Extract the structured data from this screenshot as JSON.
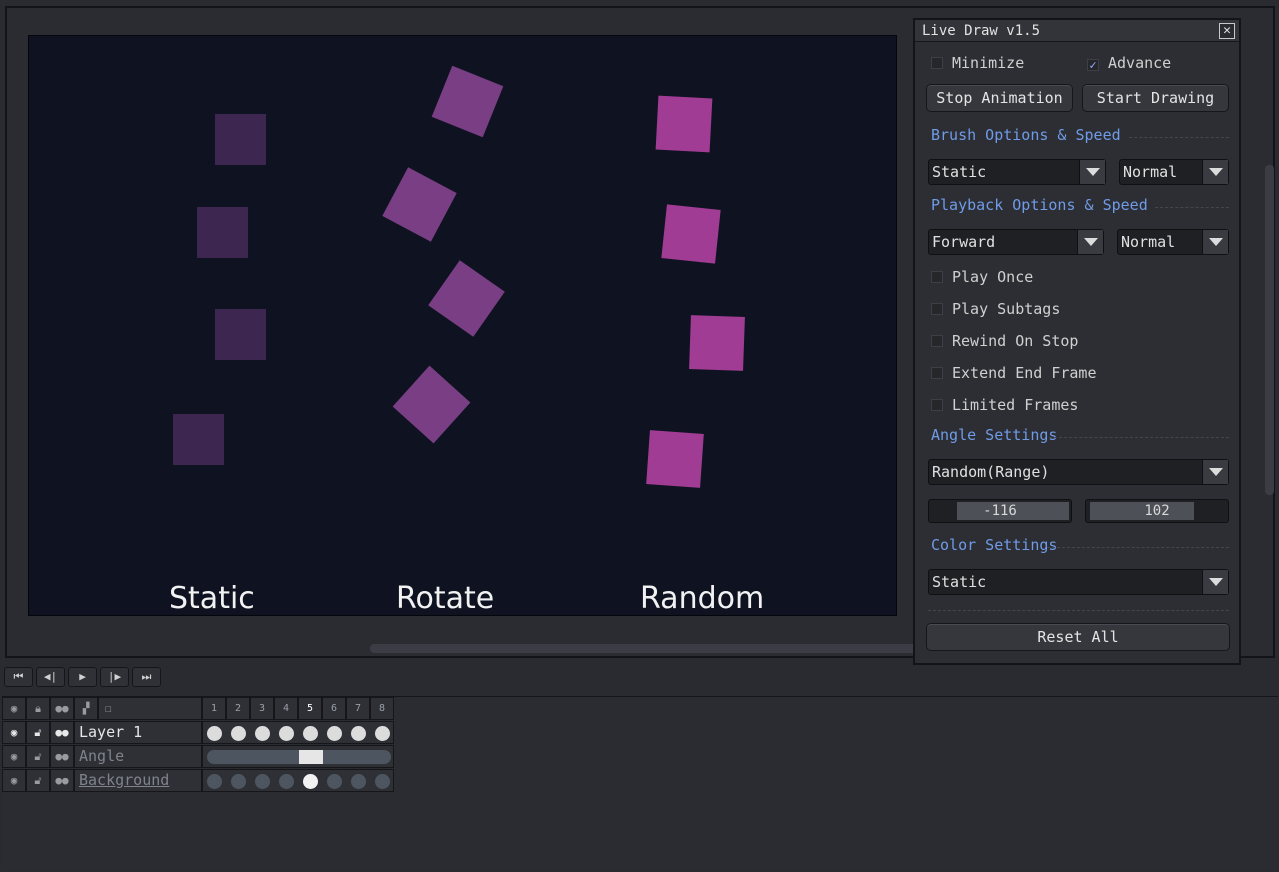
{
  "canvas": {
    "captions": [
      "Static",
      "Rotate",
      "Random"
    ]
  },
  "panel": {
    "title": "Live Draw v1.5",
    "close_icon": "✕",
    "minimize_label": "Minimize",
    "advance_label": "Advance",
    "advance_checked": true,
    "stop_animation_label": "Stop Animation",
    "start_drawing_label": "Start Drawing",
    "brush_section": "Brush Options & Speed",
    "brush_mode": "Static",
    "brush_speed": "Normal",
    "playback_section": "Playback Options & Speed",
    "playback_mode": "Forward",
    "playback_speed": "Normal",
    "options": [
      "Play Once",
      "Play Subtags",
      "Rewind On Stop",
      "Extend End Frame",
      "Limited Frames"
    ],
    "angle_section": "Angle Settings",
    "angle_mode": "Random(Range)",
    "angle_min": "-116",
    "angle_max": "102",
    "color_section": "Color Settings",
    "color_mode": "Static",
    "reset_label": "Reset All"
  },
  "transport": [
    "⏮",
    "◀|",
    "▶",
    "|▶",
    "⏭"
  ],
  "timeline": {
    "frames": [
      "1",
      "2",
      "3",
      "4",
      "5",
      "6",
      "7",
      "8"
    ],
    "current_frame": 5,
    "layers": [
      {
        "name": "Layer 1"
      },
      {
        "name": "Angle"
      },
      {
        "name": "Background"
      }
    ]
  }
}
